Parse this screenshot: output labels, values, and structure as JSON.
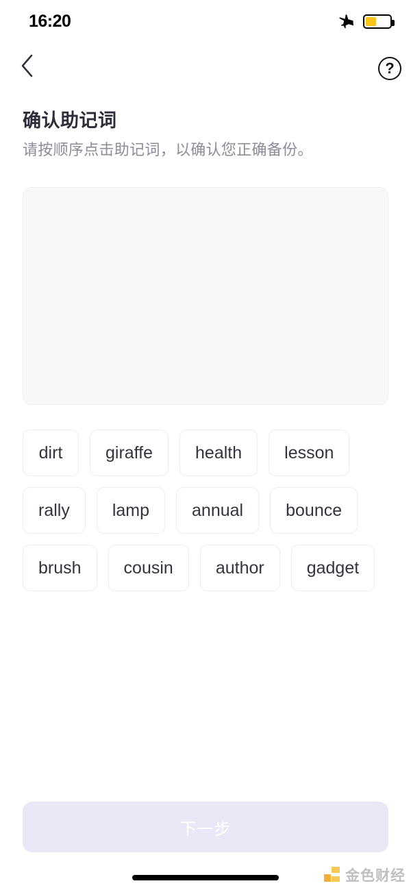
{
  "status_bar": {
    "time": "16:20",
    "airplane_icon": "airplane-icon",
    "battery_icon": "battery-icon",
    "battery_level_percent": 45,
    "battery_fill_color": "#fcc419"
  },
  "nav_bar": {
    "back_icon": "chevron-left-icon",
    "help_icon": "question-mark-circle-icon",
    "help_label": "?"
  },
  "header": {
    "title": "确认助记词",
    "subtitle": "请按顺序点击助记词，以确认您正确备份。"
  },
  "answer_area": {
    "name": "selected-words-area",
    "selected_words": [],
    "background_color": "#f8f8f9",
    "border_color": "#efeff1"
  },
  "word_bank": {
    "name": "word-bank",
    "words": [
      "dirt",
      "giraffe",
      "health",
      "lesson",
      "rally",
      "lamp",
      "annual",
      "bounce",
      "brush",
      "cousin",
      "author",
      "gadget"
    ],
    "chip_background_color": "#ffffff",
    "chip_border_color": "#ededf0",
    "chip_text_color": "#32343f"
  },
  "footer": {
    "next_label": "下一步",
    "next_enabled": false,
    "next_background_color": "#e8e8f6",
    "next_text_color": "#ffffff"
  },
  "watermark": {
    "text": "金色财经",
    "logo_icon": "jinse-logo-icon",
    "logo_color": "#f7c343"
  },
  "home_indicator": {
    "name": "home-indicator",
    "color": "#000000"
  }
}
